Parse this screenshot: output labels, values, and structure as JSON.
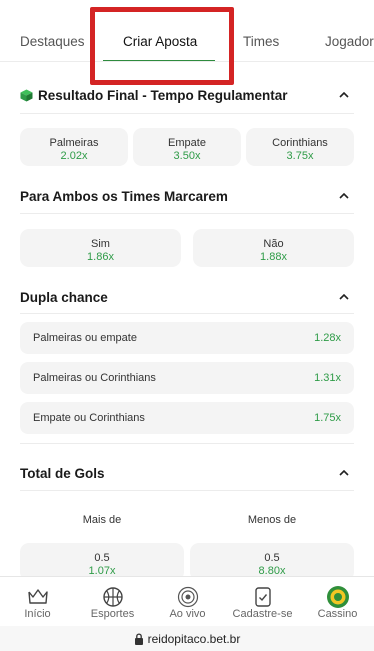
{
  "tabs": [
    {
      "label": "Destaques"
    },
    {
      "label": "Criar Aposta"
    },
    {
      "label": "Times"
    },
    {
      "label": "Jogadores"
    }
  ],
  "active_tab": "Criar Aposta",
  "accent_color": "#2e9b47",
  "highlight_color": "#d42424",
  "sections": {
    "result": {
      "title": "Resultado Final - Tempo Regulamentar",
      "options": [
        {
          "label": "Palmeiras",
          "odd": "2.02x"
        },
        {
          "label": "Empate",
          "odd": "3.50x"
        },
        {
          "label": "Corinthians",
          "odd": "3.75x"
        }
      ]
    },
    "both": {
      "title": "Para Ambos os Times Marcarem",
      "options": [
        {
          "label": "Sim",
          "odd": "1.86x"
        },
        {
          "label": "Não",
          "odd": "1.88x"
        }
      ]
    },
    "double": {
      "title": "Dupla chance",
      "rows": [
        {
          "label": "Palmeiras ou empate",
          "odd": "1.28x"
        },
        {
          "label": "Palmeiras ou Corinthians",
          "odd": "1.31x"
        },
        {
          "label": "Empate ou Corinthians",
          "odd": "1.75x"
        }
      ]
    },
    "goals": {
      "title": "Total de Gols",
      "col_over": "Mais de",
      "col_under": "Menos de",
      "over": [
        {
          "line": "0.5",
          "odd": "1.07x"
        }
      ],
      "under": [
        {
          "line": "0.5",
          "odd": "8.80x"
        }
      ]
    }
  },
  "bottom_nav": [
    {
      "label": "Início",
      "icon": "crown-icon"
    },
    {
      "label": "Esportes",
      "icon": "basketball-icon"
    },
    {
      "label": "Ao vivo",
      "icon": "live-icon"
    },
    {
      "label": "Cadastre-se",
      "icon": "signup-icon"
    },
    {
      "label": "Cassino",
      "icon": "casino-chip-icon"
    }
  ],
  "url": "reidopitaco.bet.br"
}
